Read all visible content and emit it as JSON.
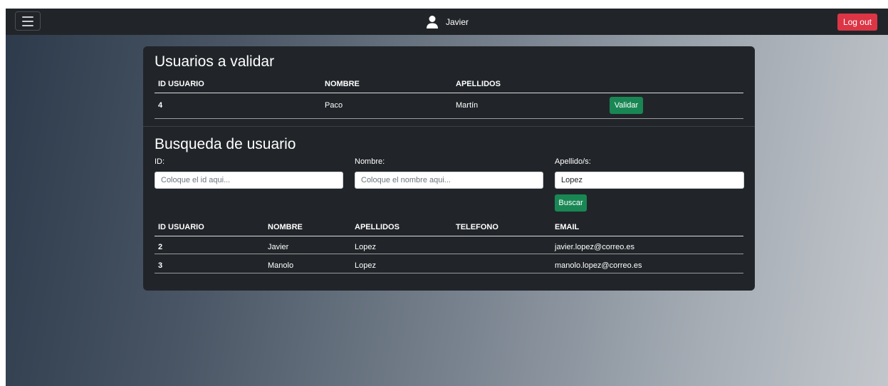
{
  "navbar": {
    "user_name": "Javier",
    "logout_label": "Log out"
  },
  "validate_section": {
    "title": "Usuarios a validar",
    "headers": [
      "ID USUARIO",
      "NOMBRE",
      "APELLIDOS"
    ],
    "rows": [
      {
        "id": "4",
        "nombre": "Paco",
        "apellidos": "Martín",
        "action": "Validar"
      }
    ]
  },
  "search_section": {
    "title": "Busqueda de usuario",
    "id_label": "ID:",
    "id_placeholder": "Coloque el id aqui...",
    "id_value": "",
    "nombre_label": "Nombre:",
    "nombre_placeholder": "Coloque el nombre aqui...",
    "nombre_value": "",
    "apellidos_label": "Apellido/s:",
    "apellidos_value": "Lopez",
    "search_button": "Buscar"
  },
  "results_section": {
    "headers": [
      "ID USUARIO",
      "NOMBRE",
      "APELLIDOS",
      "TELEFONO",
      "EMAIL"
    ],
    "rows": [
      {
        "id": "2",
        "nombre": "Javier",
        "apellidos": "Lopez",
        "telefono": "",
        "email": "javier.lopez@correo.es"
      },
      {
        "id": "3",
        "nombre": "Manolo",
        "apellidos": "Lopez",
        "telefono": "",
        "email": "manolo.lopez@correo.es"
      }
    ]
  },
  "colors": {
    "navbar": "#212529",
    "card": "#212529",
    "logout": "#dc3545",
    "action_green": "#198754"
  }
}
